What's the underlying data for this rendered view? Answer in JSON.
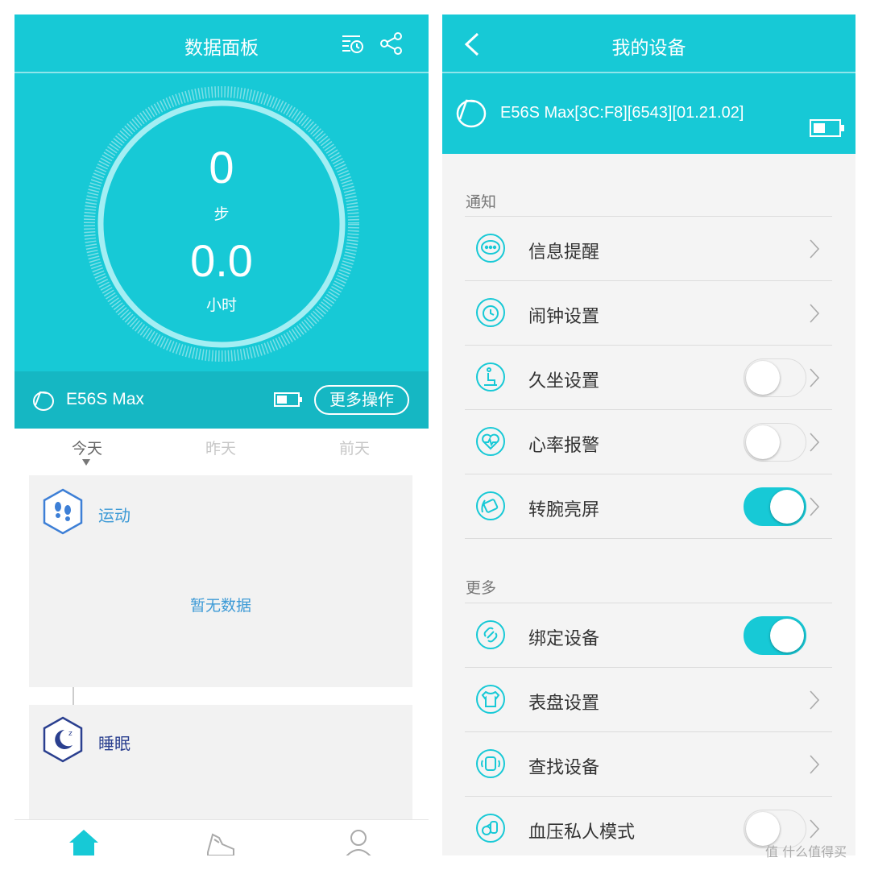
{
  "left": {
    "header": {
      "title": "数据面板",
      "icons": [
        "history-list-icon",
        "share-icon"
      ]
    },
    "hero": {
      "steps_value": "0",
      "steps_unit": "步",
      "hours_value": "0.0",
      "hours_unit": "小时"
    },
    "device_bar": {
      "name": "E56S Max",
      "more_button": "更多操作"
    },
    "days": {
      "today": "今天",
      "yesterday": "昨天",
      "day_before": "前天",
      "selected": "今天"
    },
    "cards": {
      "sport": {
        "title": "运动",
        "empty_text": "暂无数据"
      },
      "sleep": {
        "title": "睡眠"
      }
    },
    "tabs": [
      "home-icon",
      "shoe-icon",
      "profile-icon"
    ]
  },
  "right": {
    "header": {
      "title": "我的设备"
    },
    "device": {
      "label": "E56S Max[3C:F8][6543][01.21.02]"
    },
    "sections": {
      "notify": "通知",
      "more": "更多"
    },
    "items": [
      {
        "label": "信息提醒",
        "icon": "message-icon",
        "control": "chevron"
      },
      {
        "label": "闹钟设置",
        "icon": "alarm-clock-icon",
        "control": "chevron"
      },
      {
        "label": "久坐设置",
        "icon": "sedentary-icon",
        "control": "toggle",
        "on": false
      },
      {
        "label": "心率报警",
        "icon": "heart-rate-icon",
        "control": "toggle",
        "on": false
      },
      {
        "label": "转腕亮屏",
        "icon": "wrist-turn-icon",
        "control": "toggle",
        "on": true
      },
      {
        "label": "绑定设备",
        "icon": "link-icon",
        "control": "toggle",
        "on": true
      },
      {
        "label": "表盘设置",
        "icon": "shirt-icon",
        "control": "chevron"
      },
      {
        "label": "查找设备",
        "icon": "find-device-icon",
        "control": "chevron"
      },
      {
        "label": "血压私人模式",
        "icon": "blood-pressure-icon",
        "control": "toggle",
        "on": false
      }
    ]
  },
  "watermark": "值 什么值得买",
  "colors": {
    "accent": "#17c9d6",
    "accent_dark": "#15b7c3",
    "link_blue": "#3d9ad6",
    "sleep_navy": "#2a3f8f"
  }
}
